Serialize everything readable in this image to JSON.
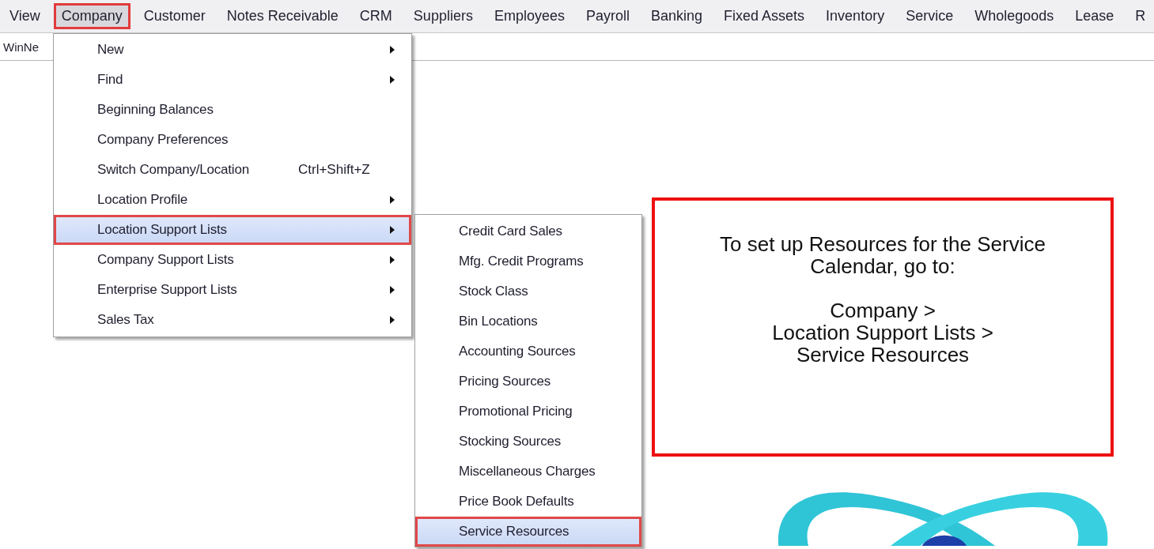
{
  "menubar": [
    {
      "label": "View",
      "selected": false,
      "outlined": false
    },
    {
      "label": "Company",
      "selected": true,
      "outlined": true
    },
    {
      "label": "Customer",
      "selected": false,
      "outlined": false
    },
    {
      "label": "Notes Receivable",
      "selected": false,
      "outlined": false
    },
    {
      "label": "CRM",
      "selected": false,
      "outlined": false
    },
    {
      "label": "Suppliers",
      "selected": false,
      "outlined": false
    },
    {
      "label": "Employees",
      "selected": false,
      "outlined": false
    },
    {
      "label": "Payroll",
      "selected": false,
      "outlined": false
    },
    {
      "label": "Banking",
      "selected": false,
      "outlined": false
    },
    {
      "label": "Fixed Assets",
      "selected": false,
      "outlined": false
    },
    {
      "label": "Inventory",
      "selected": false,
      "outlined": false
    },
    {
      "label": "Service",
      "selected": false,
      "outlined": false
    },
    {
      "label": "Wholegoods",
      "selected": false,
      "outlined": false
    },
    {
      "label": "Lease",
      "selected": false,
      "outlined": false
    },
    {
      "label": "R",
      "selected": false,
      "outlined": false
    }
  ],
  "tab_strip": {
    "label": "WinNe"
  },
  "company_menu": [
    {
      "label": "New",
      "submenu": true,
      "selected": false,
      "outlined": false
    },
    {
      "label": "Find",
      "submenu": true,
      "selected": false,
      "outlined": false
    },
    {
      "label": "Beginning Balances",
      "submenu": false,
      "selected": false,
      "outlined": false
    },
    {
      "label": "Company Preferences",
      "submenu": false,
      "selected": false,
      "outlined": false
    },
    {
      "label": "Switch Company/Location",
      "shortcut": "Ctrl+Shift+Z",
      "submenu": false,
      "selected": false,
      "outlined": false
    },
    {
      "label": "Location Profile",
      "submenu": true,
      "selected": false,
      "outlined": false
    },
    {
      "label": "Location Support Lists",
      "submenu": true,
      "selected": true,
      "outlined": true
    },
    {
      "label": "Company Support Lists",
      "submenu": true,
      "selected": false,
      "outlined": false
    },
    {
      "label": "Enterprise Support Lists",
      "submenu": true,
      "selected": false,
      "outlined": false
    },
    {
      "label": "Sales Tax",
      "submenu": true,
      "selected": false,
      "outlined": false
    }
  ],
  "location_support_menu": [
    {
      "label": "Credit Card Sales",
      "selected": false,
      "outlined": false
    },
    {
      "label": "Mfg. Credit Programs",
      "selected": false,
      "outlined": false
    },
    {
      "label": "Stock Class",
      "selected": false,
      "outlined": false
    },
    {
      "label": "Bin Locations",
      "selected": false,
      "outlined": false
    },
    {
      "label": "Accounting Sources",
      "selected": false,
      "outlined": false
    },
    {
      "label": "Pricing Sources",
      "selected": false,
      "outlined": false
    },
    {
      "label": "Promotional Pricing",
      "selected": false,
      "outlined": false
    },
    {
      "label": "Stocking Sources",
      "selected": false,
      "outlined": false
    },
    {
      "label": "Miscellaneous Charges",
      "selected": false,
      "outlined": false
    },
    {
      "label": "Price Book Defaults",
      "selected": false,
      "outlined": false
    },
    {
      "label": "Service Resources",
      "selected": true,
      "outlined": true
    }
  ],
  "callout": {
    "paragraphs": [
      "To set up Resources for the Service\nCalendar, go to:",
      "Company >\nLocation Support Lists >\nService Resources"
    ]
  }
}
